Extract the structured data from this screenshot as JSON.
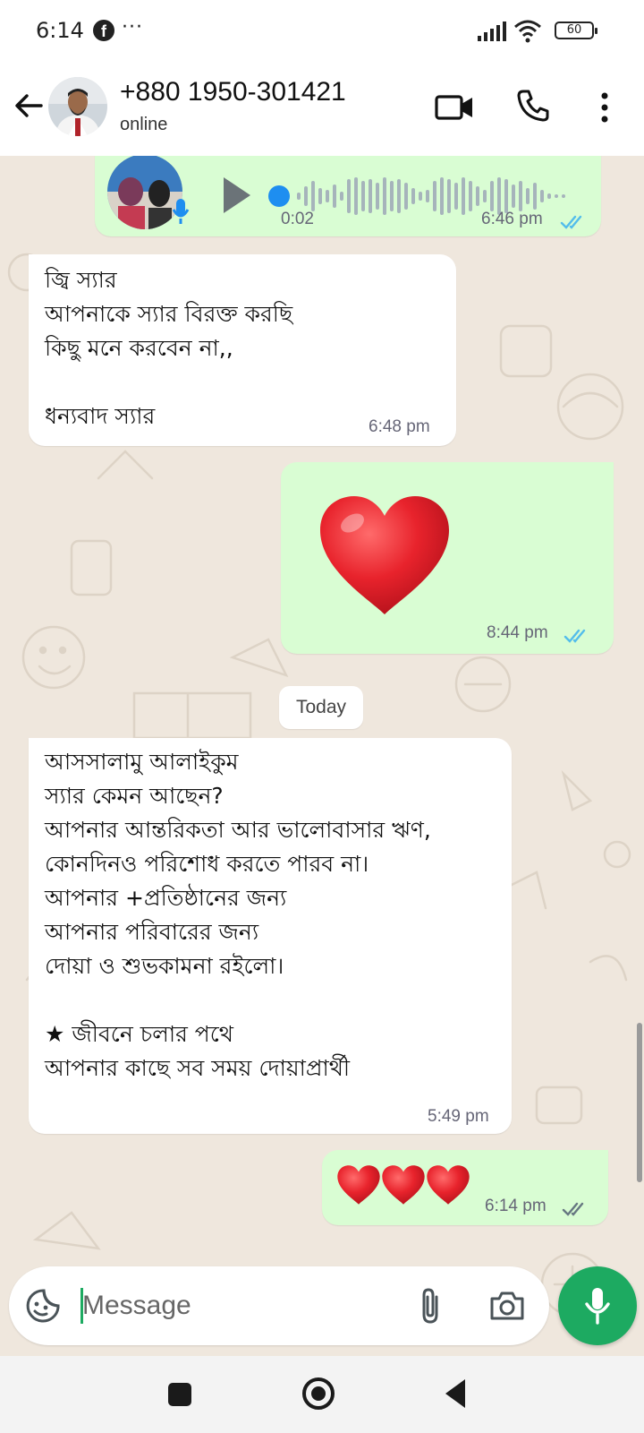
{
  "status_bar": {
    "time": "6:14",
    "notification_dots": "···",
    "battery": "60"
  },
  "header": {
    "contact_name": "+880 1950-301421",
    "contact_status": "online"
  },
  "messages": [
    {
      "type": "voice",
      "direction": "outgoing",
      "duration": "0:02",
      "time": "6:46 pm",
      "read": true,
      "progress": 0
    },
    {
      "type": "text",
      "direction": "incoming",
      "text": "জ্বি স্যার\nআপনাকে স্যার বিরক্ত করছি\nকিছু মনে করবেন না,,\n\nধন্যবাদ স্যার",
      "time": "6:48 pm"
    },
    {
      "type": "emoji",
      "direction": "outgoing",
      "emoji": "❤️",
      "time": "8:44 pm",
      "read": true
    },
    {
      "type": "text",
      "direction": "incoming",
      "text": "আসসালামু আলাইকুম\nস্যার কেমন আছেন?\nআপনার আন্তরিকতা আর ভালোবাসার ঋণ,\nকোনদিনও পরিশোধ করতে পারব না।\nআপনার +প্রতিষ্ঠানের জন্য\nআপনার পরিবারের জন্য\nদোয়া ও শুভকামনা রইলো।\n\n★ জীবনে চলার পথে\nআপনার কাছে সব সময় দোয়াপ্রার্থী",
      "time": "5:49 pm"
    },
    {
      "type": "emoji",
      "direction": "outgoing",
      "emoji": "❤️❤️❤️",
      "time": "6:14 pm",
      "read": false
    }
  ],
  "date_separator": "Today",
  "input": {
    "placeholder": "Message"
  },
  "icons": {
    "back": "arrow-left-icon",
    "video": "video-call-icon",
    "call": "phone-icon",
    "menu": "more-vert-icon",
    "emoji": "sticker-emoji-icon",
    "attach": "paperclip-icon",
    "camera": "camera-icon",
    "mic": "microphone-icon"
  },
  "colors": {
    "accent_green": "#1daa61",
    "outgoing_bubble": "#d9fdd3",
    "incoming_bubble": "#ffffff",
    "read_ticks": "#53bdeb",
    "chat_background": "#efe7dd",
    "voice_dot": "#1e8ef0"
  }
}
